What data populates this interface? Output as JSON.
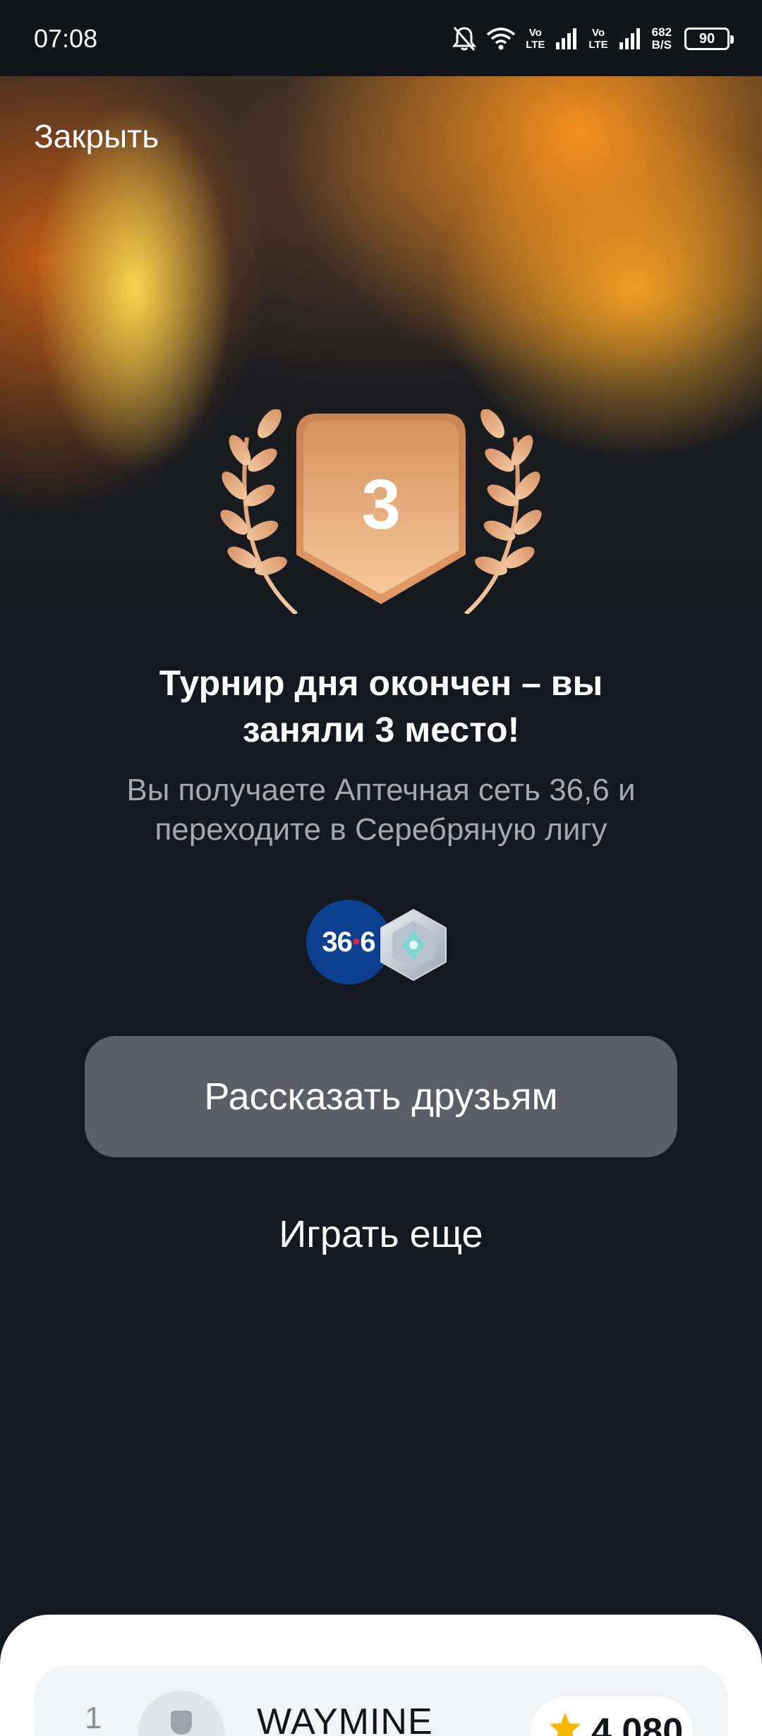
{
  "status_bar": {
    "time": "07:08",
    "lte1_top": "Vo",
    "lte1_bottom": "LTE",
    "lte2_top": "Vo",
    "lte2_bottom": "LTE",
    "speed_value": "682",
    "speed_unit": "B/S",
    "battery": "90",
    "icons": [
      "bell-off-icon",
      "wifi-icon",
      "signal-icon",
      "signal-icon",
      "battery-icon"
    ]
  },
  "header": {
    "close_label": "Закрыть"
  },
  "result": {
    "place": "3",
    "title": "Турнир дня окончен – вы заняли 3 место!",
    "subtitle": "Вы получаете Аптечная сеть 36,6 и переходите в Серебряную лигу",
    "partner_logo_left": "36",
    "partner_logo_right": "6"
  },
  "actions": {
    "share_label": "Рассказать друзьям",
    "play_again_label": "Играть еще"
  },
  "leaderboard": {
    "rows": [
      {
        "rank": "1",
        "name": "WAYMINE",
        "score": "4 080"
      }
    ]
  },
  "colors": {
    "background": "#141820",
    "button": "#5b5e66",
    "medal": "#e7a66f",
    "partner_blue": "#0d3f8f",
    "star": "#f5b800"
  }
}
